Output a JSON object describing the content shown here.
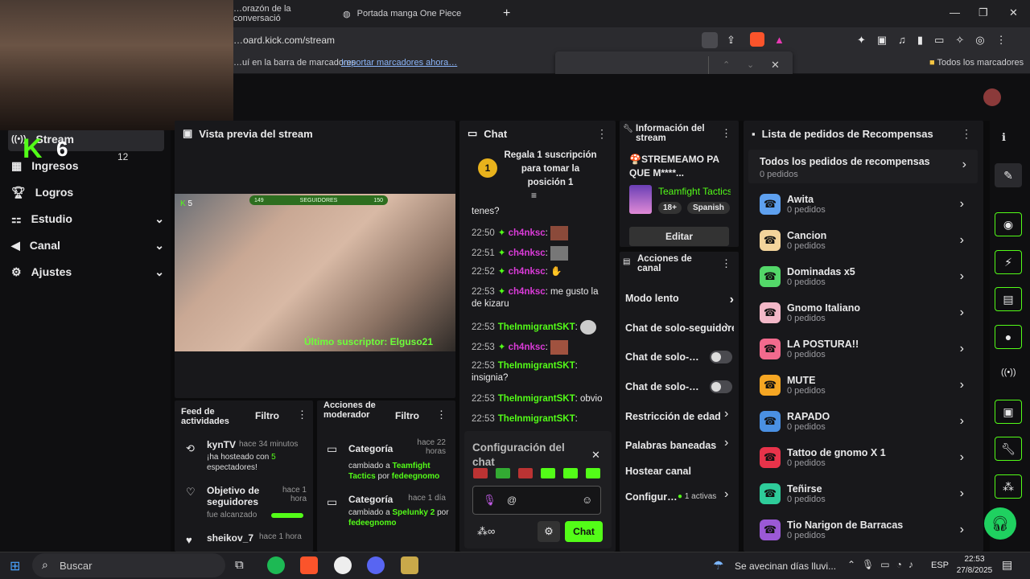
{
  "browser": {
    "tabs": [
      "…orazón de la conversació",
      "Portada manga One Piece"
    ],
    "url": "…oard.kick.com/stream",
    "bookmarks_text": "…uí en la barra de marcadores",
    "import_link": "Importar marcadores ahora…",
    "all_bookmarks": "Todos los marcadores"
  },
  "sidebar": {
    "items": [
      {
        "label": "Stream",
        "icon": "stream-icon"
      },
      {
        "label": "Ingresos",
        "icon": "income-icon"
      },
      {
        "label": "Logros",
        "icon": "trophy-icon"
      },
      {
        "label": "Estudio",
        "icon": "studio-icon",
        "chev": "⌄"
      },
      {
        "label": "Canal",
        "icon": "channel-icon",
        "chev": "⌄"
      },
      {
        "label": "Ajustes",
        "icon": "gear-icon",
        "chev": "⌄"
      }
    ]
  },
  "webcam": {
    "badge_k": "K",
    "badge_num": "6",
    "overlay_num": "12"
  },
  "preview": {
    "title": "Vista previa del stream",
    "viewers": "5",
    "followers_label": "SEGUIDORES",
    "followers_left": "149",
    "followers_right": "150",
    "last_sub": "Último suscriptor: Elguso21"
  },
  "activity": {
    "title": "Feed de actividades",
    "filter": "Filtro",
    "items": [
      {
        "user": "kynTV",
        "time": "hace 34 minutos",
        "text_a": "¡ha hosteado con ",
        "count": "5",
        "text_b": " espectadores!"
      },
      {
        "user": "Objetivo de seguidores",
        "time": "hace 1 hora",
        "text": "fue alcanzado"
      },
      {
        "user": "sheikov_7",
        "time": "hace 1 hora"
      }
    ]
  },
  "modactions": {
    "title": "Acciones de moderador",
    "filter": "Filtro",
    "items": [
      {
        "label": "Categoría",
        "time": "hace 22 horas",
        "text": "cambiado a ",
        "cat": "Teamfight Tactics",
        "by": " por ",
        "mod": "fedeegnomo"
      },
      {
        "label": "Categoría",
        "time": "hace 1 día",
        "text": "cambiado a ",
        "cat": "Spelunky 2",
        "by": " por ",
        "mod": "fedeegnomo"
      }
    ]
  },
  "chat": {
    "title": "Chat",
    "gift": "Regala 1 suscripción para tomar la posición 1",
    "gift_rank": "1",
    "top_text": "tenes?",
    "lines": [
      {
        "ts": "22:50",
        "user": "ch4nksc",
        "msg": ""
      },
      {
        "ts": "22:51",
        "user": "ch4nksc",
        "msg": ""
      },
      {
        "ts": "22:52",
        "user": "ch4nksc",
        "msg": ""
      },
      {
        "ts": "22:53",
        "user": "ch4nksc",
        "msg": "me gusto la de kizaru"
      },
      {
        "ts": "22:53",
        "user": "TheInmigrantSKT",
        "msg": ""
      },
      {
        "ts": "22:53",
        "user": "ch4nksc",
        "msg": ""
      },
      {
        "ts": "22:53",
        "user": "TheInmigrantSKT",
        "msg": "insignia?"
      },
      {
        "ts": "22:53",
        "user": "TheInmigrantSKT",
        "msg": "obvio"
      },
      {
        "ts": "22:53",
        "user": "TheInmigrantSKT",
        "msg": ""
      }
    ],
    "config_title": "Configuración del chat",
    "input_placeholder": "@",
    "send": "Chat"
  },
  "info": {
    "title": "Información del stream",
    "stream_title": "🍄STREMEAMO PA QUE M****...",
    "category": "Teamfight Tactics",
    "tags": [
      "18+",
      "Spanish"
    ],
    "edit": "Editar"
  },
  "channel_actions": {
    "title": "Acciones de canal",
    "items": [
      {
        "label": "Modo lento",
        "type": "chev"
      },
      {
        "label": "Chat de solo-seguidores",
        "type": "chev"
      },
      {
        "label": "Chat de solo-…",
        "type": "toggle"
      },
      {
        "label": "Chat de solo-…",
        "type": "toggle"
      },
      {
        "label": "Restricción de edad",
        "type": "chev"
      },
      {
        "label": "Palabras baneadas",
        "type": "chev"
      },
      {
        "label": "Hostear canal",
        "type": "none"
      },
      {
        "label": "Configur…",
        "type": "active",
        "active": "1 activas"
      }
    ]
  },
  "rewards": {
    "title": "Lista de pedidos de Recompensas",
    "all": "Todos los pedidos de recompensas",
    "all_sub": "0 pedidos",
    "items": [
      {
        "name": "Awita",
        "sub": "0 pedidos",
        "color": "#5ea0ef"
      },
      {
        "name": "Cancion",
        "sub": "0 pedidos",
        "color": "#f3d49b"
      },
      {
        "name": "Dominadas x5",
        "sub": "0 pedidos",
        "color": "#53d769"
      },
      {
        "name": "Gnomo Italiano",
        "sub": "0 pedidos",
        "color": "#f3b8c8"
      },
      {
        "name": "LA POSTURA!!",
        "sub": "0 pedidos",
        "color": "#f26a8d"
      },
      {
        "name": "MUTE",
        "sub": "0 pedidos",
        "color": "#f5a623"
      },
      {
        "name": "RAPADO",
        "sub": "0 pedidos",
        "color": "#4a90e2"
      },
      {
        "name": "Tattoo de gnomo X 1",
        "sub": "0 pedidos",
        "color": "#e8334a"
      },
      {
        "name": "Teñirse",
        "sub": "0 pedidos",
        "color": "#2ecc9a"
      },
      {
        "name": "Tio Narigon de Barracas",
        "sub": "0 pedidos",
        "color": "#9b59d6"
      }
    ]
  },
  "taskbar": {
    "search": "Buscar",
    "weather": "Se avecinan días lluvi...",
    "lang": "ESP",
    "time": "22:53",
    "date": "27/8/2025"
  }
}
